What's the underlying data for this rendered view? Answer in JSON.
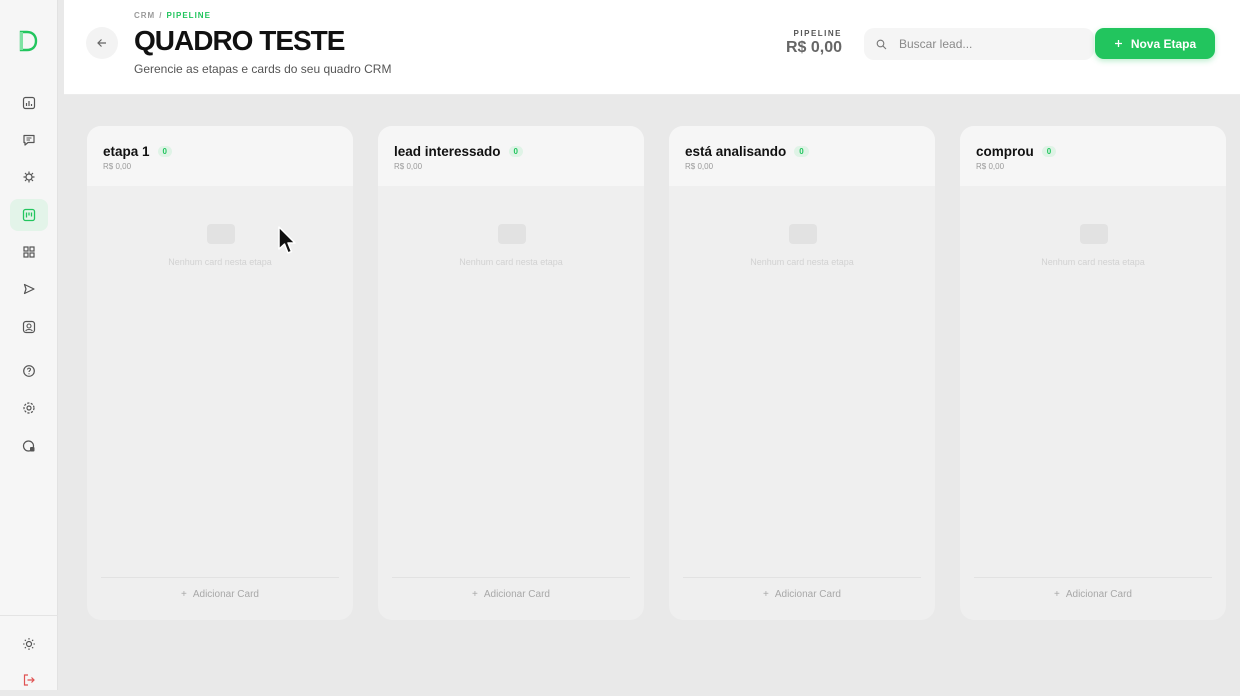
{
  "sidebar": {
    "items": [
      {
        "icon": "chart-icon"
      },
      {
        "icon": "chat-icon"
      },
      {
        "icon": "gear-bug-icon"
      },
      {
        "icon": "kanban-icon",
        "active": true
      },
      {
        "icon": "grid-icon"
      },
      {
        "icon": "send-icon"
      },
      {
        "icon": "contact-card-icon"
      },
      {
        "icon": "help-icon"
      },
      {
        "icon": "settings-icon"
      },
      {
        "icon": "security-icon"
      },
      {
        "icon": "sun-icon"
      },
      {
        "icon": "logout-icon"
      }
    ]
  },
  "header": {
    "breadcrumb": [
      "CRM",
      "PIPELINE"
    ],
    "breadcrumb_separator": "/",
    "title": "QUADRO TESTE",
    "subtitle": "Gerencie as etapas e cards do seu quadro CRM",
    "pipeline_label": "PIPELINE",
    "pipeline_value": "R$ 0,00",
    "search_placeholder": "Buscar lead...",
    "new_stage_label": "Nova Etapa"
  },
  "board": {
    "columns": [
      {
        "title": "etapa 1",
        "count": "0",
        "total": "R$ 0,00",
        "empty_text": "Nenhum card nesta etapa",
        "add_label": "Adicionar Card"
      },
      {
        "title": "lead interessado",
        "count": "0",
        "total": "R$ 0,00",
        "empty_text": "Nenhum card nesta etapa",
        "add_label": "Adicionar Card"
      },
      {
        "title": "está analisando",
        "count": "0",
        "total": "R$ 0,00",
        "empty_text": "Nenhum card nesta etapa",
        "add_label": "Adicionar Card"
      },
      {
        "title": "comprou",
        "count": "0",
        "total": "R$ 0,00",
        "empty_text": "Nenhum card nesta etapa",
        "add_label": "Adicionar Card"
      }
    ]
  },
  "colors": {
    "accent": "#22c55e",
    "sidebar_active_bg": "#e3f4e9",
    "logout": "#e05252"
  }
}
